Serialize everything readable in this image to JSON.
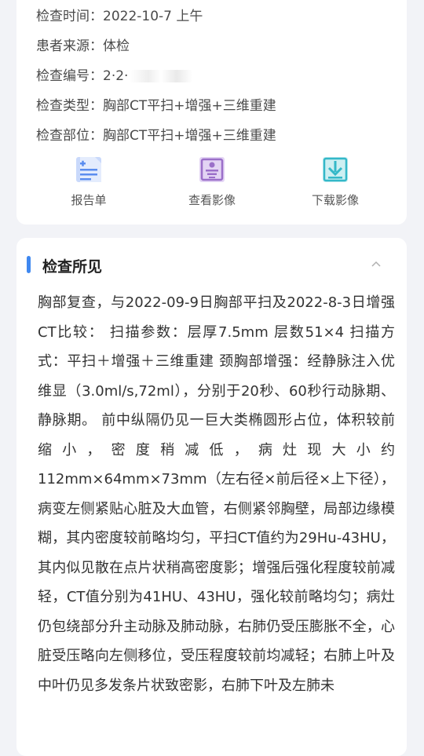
{
  "exam_info": {
    "rows": [
      {
        "key": "检查时间：",
        "value": "2022-10-7 上午"
      },
      {
        "key": "患者来源：",
        "value": "体检"
      },
      {
        "key": "检查编号：",
        "value": "2·2·"
      },
      {
        "key": "检查类型：",
        "value": "胸部CT平扫+增强+三维重建"
      },
      {
        "key": "检查部位：",
        "value": "胸部CT平扫+增强+三维重建"
      }
    ],
    "actions": [
      {
        "label": "报告单",
        "icon": "report-icon",
        "color": "#5b8def"
      },
      {
        "label": "查看影像",
        "icon": "view-image-icon",
        "color": "#9b6fc9"
      },
      {
        "label": "下载影像",
        "icon": "download-image-icon",
        "color": "#34b8c8"
      }
    ]
  },
  "findings": {
    "title": "检查所见",
    "accent": "#3f88f0",
    "text": "胸部复查，与2022-09-9日胸部平扫及2022-8-3日增强CT比较： 扫描参数：层厚7.5mm 层数51×4 扫描方式：平扫＋增强＋三维重建 颈胸部增强：经静脉注入优维显（3.0ml/s,72ml），分别于20秒、60秒行动脉期、静脉期。 前中纵隔仍见一巨大类椭圆形占位，体积较前缩小，密度稍减低，病灶现大小约112mm×64mm×73mm（左右径×前后径×上下径），病变左侧紧贴心脏及大血管，右侧紧邻胸壁，局部边缘模糊，其内密度较前略均匀，平扫CT值约为29Hu-43HU，其内似见散在点片状稍高密度影；增强后强化程度较前减轻，CT值分别为41HU、43HU，强化较前略均匀；病灶仍包绕部分升主动脉及肺动脉，右肺仍受压膨胀不全，心脏受压略向左侧移位，受压程度较前均减轻；右肺上叶及中叶仍见多发条片状致密影，右肺下叶及左肺未"
  }
}
